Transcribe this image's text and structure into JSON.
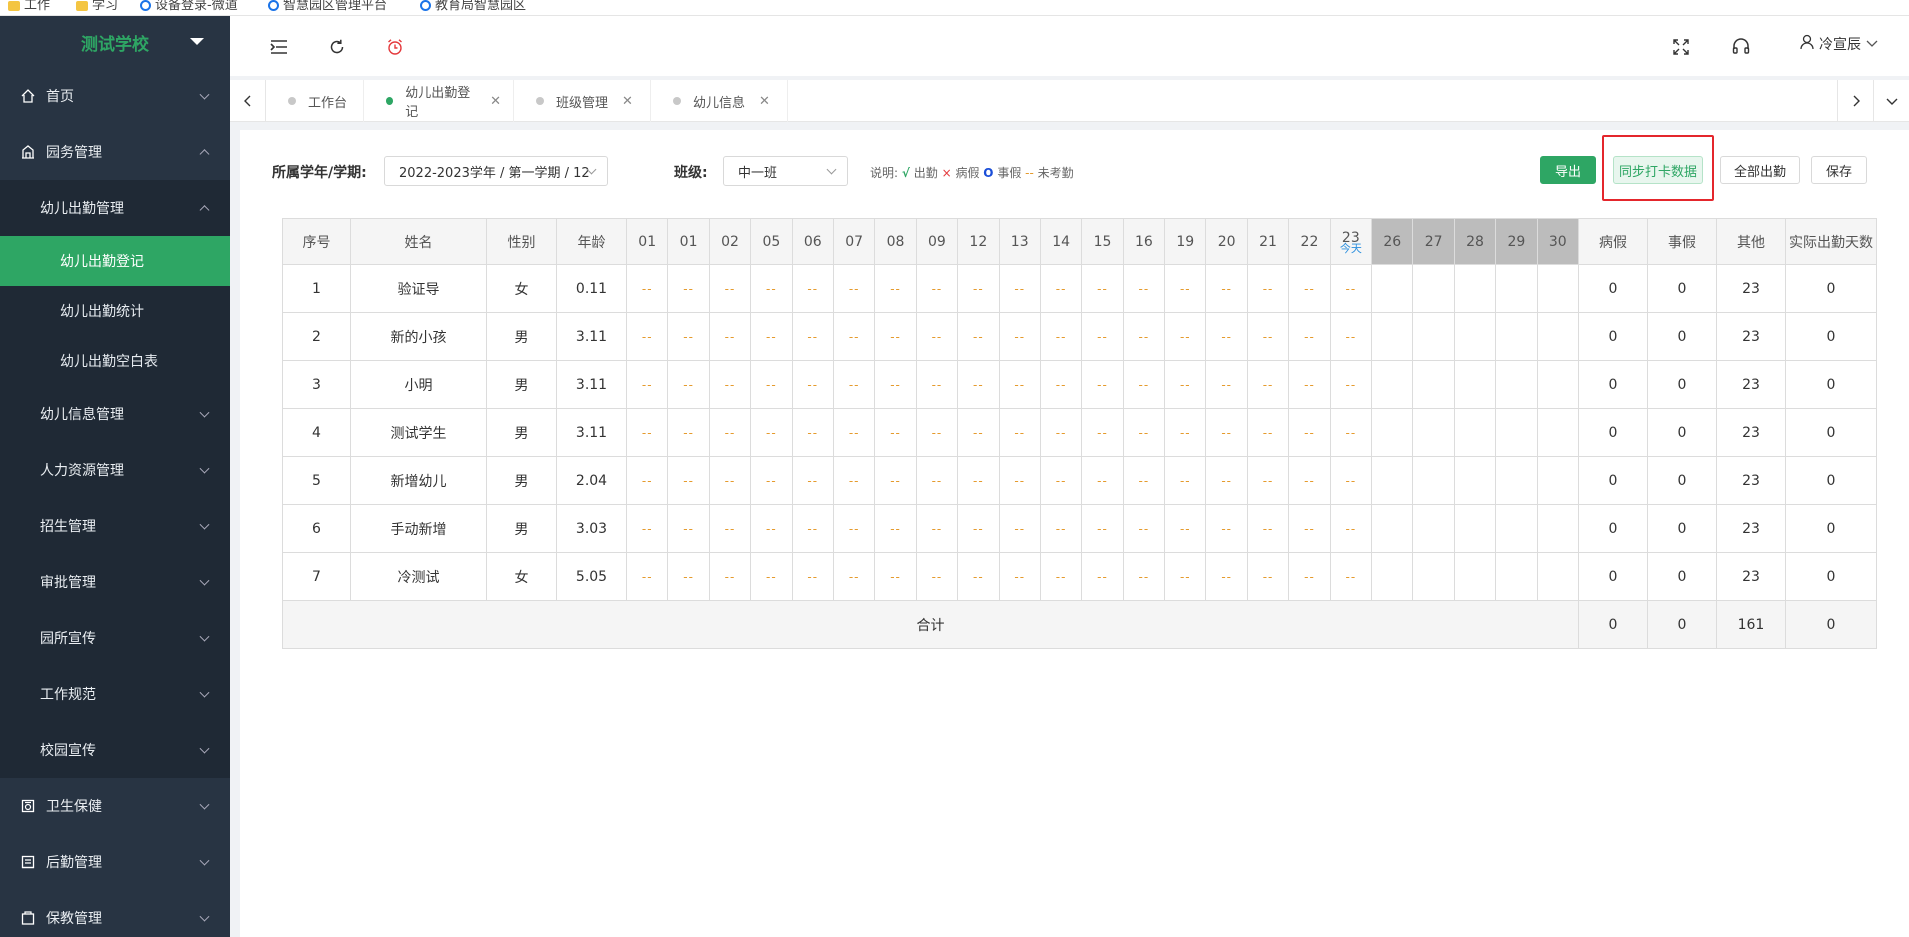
{
  "browser": {
    "bookmarks": [
      "工作",
      "学习",
      "设备登录-微道",
      "智慧园区管理平台",
      "教育局智慧园区"
    ]
  },
  "sidebar": {
    "brand": "测试学校",
    "items": [
      {
        "label": "首页",
        "icon": "home-icon"
      },
      {
        "label": "园务管理",
        "icon": "building-icon",
        "expanded": true
      },
      {
        "label": "卫生保健",
        "icon": "health-icon"
      },
      {
        "label": "后勤管理",
        "icon": "logistics-icon"
      },
      {
        "label": "保教管理",
        "icon": "education-icon"
      }
    ],
    "sub": {
      "attendance_group": "幼儿出勤管理",
      "attendance_items": [
        "幼儿出勤登记",
        "幼儿出勤统计",
        "幼儿出勤空白表"
      ],
      "others": [
        "幼儿信息管理",
        "人力资源管理",
        "招生管理",
        "审批管理",
        "园所宣传",
        "工作规范",
        "校园宣传"
      ]
    }
  },
  "header": {
    "user_name": "冷宣辰",
    "icons": [
      "menu-fold-icon",
      "refresh-icon",
      "alarm-clock-icon",
      "fullscreen-icon",
      "headset-icon",
      "user-icon"
    ]
  },
  "tabs": [
    {
      "label": "工作台",
      "active": false,
      "closable": false
    },
    {
      "label": "幼儿出勤登记",
      "active": true,
      "closable": true
    },
    {
      "label": "班级管理",
      "active": false,
      "closable": true
    },
    {
      "label": "幼儿信息",
      "active": false,
      "closable": true
    }
  ],
  "filters": {
    "term_label": "所属学年/学期:",
    "term_value": "2022-2023学年 / 第一学期 / 12",
    "class_label": "班级:",
    "class_value": "中一班",
    "legend_prefix": "说明:",
    "legend_ok": "√",
    "legend_ok_text": "出勤",
    "legend_sick": "×",
    "legend_sick_text": "病假",
    "legend_leave": "O",
    "legend_leave_text": "事假",
    "legend_none": "--",
    "legend_none_text": "未考勤"
  },
  "buttons": {
    "export": "导出",
    "sync": "同步打卡数据",
    "all_present": "全部出勤",
    "save": "保存"
  },
  "table": {
    "headers": {
      "no": "序号",
      "name": "姓名",
      "gender": "性别",
      "age": "年龄",
      "sick": "病假",
      "leave": "事假",
      "other": "其他",
      "actual": "实际出勤天数"
    },
    "days": [
      "01",
      "01",
      "02",
      "05",
      "06",
      "07",
      "08",
      "09",
      "12",
      "13",
      "14",
      "15",
      "16",
      "19",
      "20",
      "21",
      "22",
      "23"
    ],
    "future_days": [
      "26",
      "27",
      "28",
      "29",
      "30"
    ],
    "today_label": "今天",
    "today_index": 17,
    "unmarked": "--",
    "rows": [
      {
        "no": "1",
        "name": "验证导",
        "gender": "女",
        "age": "0.11",
        "sick": "0",
        "leave": "0",
        "other": "23",
        "actual": "0"
      },
      {
        "no": "2",
        "name": "新的小孩",
        "gender": "男",
        "age": "3.11",
        "sick": "0",
        "leave": "0",
        "other": "23",
        "actual": "0"
      },
      {
        "no": "3",
        "name": "小明",
        "gender": "男",
        "age": "3.11",
        "sick": "0",
        "leave": "0",
        "other": "23",
        "actual": "0"
      },
      {
        "no": "4",
        "name": "测试学生",
        "gender": "男",
        "age": "3.11",
        "sick": "0",
        "leave": "0",
        "other": "23",
        "actual": "0"
      },
      {
        "no": "5",
        "name": "新增幼儿",
        "gender": "男",
        "age": "2.04",
        "sick": "0",
        "leave": "0",
        "other": "23",
        "actual": "0"
      },
      {
        "no": "6",
        "name": "手动新增",
        "gender": "男",
        "age": "3.03",
        "sick": "0",
        "leave": "0",
        "other": "23",
        "actual": "0"
      },
      {
        "no": "7",
        "name": "冷测试",
        "gender": "女",
        "age": "5.05",
        "sick": "0",
        "leave": "0",
        "other": "23",
        "actual": "0"
      }
    ],
    "total": {
      "label": "合计",
      "sick": "0",
      "leave": "0",
      "other": "161",
      "actual": "0"
    }
  },
  "colors": {
    "accent": "#2ea664",
    "sidebar_bg": "#283443",
    "highlight": "#e4262c",
    "unmarked": "#e59b2d",
    "today": "#2b8fde"
  }
}
